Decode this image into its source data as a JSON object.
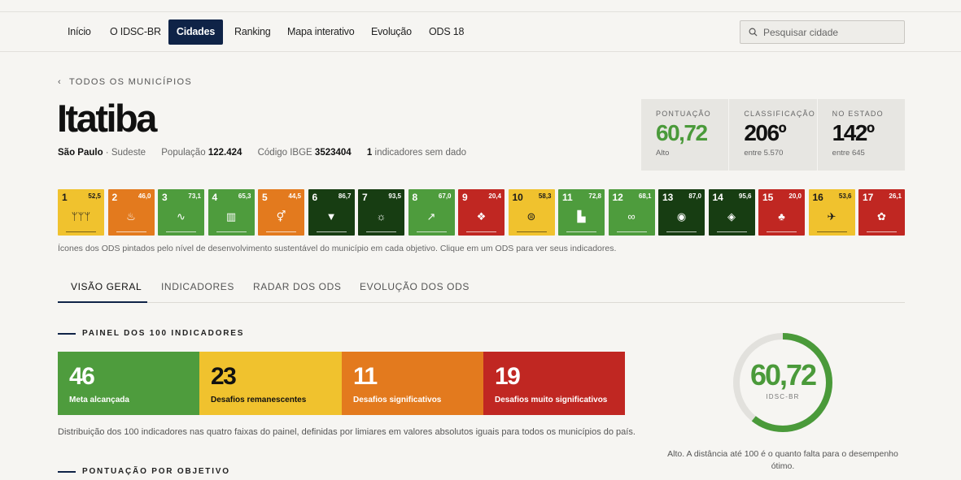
{
  "nav": {
    "items": [
      {
        "label": "Início"
      },
      {
        "label": "O IDSC-BR"
      },
      {
        "label": "Cidades"
      },
      {
        "label": "Ranking"
      },
      {
        "label": "Mapa interativo"
      },
      {
        "label": "Evolução"
      },
      {
        "label": "ODS 18"
      }
    ],
    "search_placeholder": "Pesquisar cidade"
  },
  "back_link": "TODOS OS MUNICÍPIOS",
  "city": {
    "name": "Itatiba",
    "state": "São Paulo",
    "region": "Sudeste",
    "population_label": "População",
    "population": "122.424",
    "ibge_label": "Código IBGE",
    "ibge": "3523404",
    "missing_count": "1",
    "missing_label": "indicadores sem dado"
  },
  "stats": [
    {
      "label": "PONTUAÇÃO",
      "value": "60,72",
      "sub": "Alto"
    },
    {
      "label": "CLASSIFICAÇÃO",
      "value": "206º",
      "sub": "entre 5.570"
    },
    {
      "label": "NO ESTADO",
      "value": "142º",
      "sub": "entre 645"
    }
  ],
  "ods": [
    {
      "num": "1",
      "score": "52,5",
      "color": "#f0c22e",
      "icon": "people-icon",
      "glyph": "ᛘᛘᛘ"
    },
    {
      "num": "2",
      "score": "46,0",
      "color": "#e37a1e",
      "icon": "bowl-icon",
      "glyph": "♨"
    },
    {
      "num": "3",
      "score": "73,1",
      "color": "#4e9c3d",
      "icon": "heartbeat-icon",
      "glyph": "∿"
    },
    {
      "num": "4",
      "score": "65,3",
      "color": "#4e9c3d",
      "icon": "book-icon",
      "glyph": "▥"
    },
    {
      "num": "5",
      "score": "44,5",
      "color": "#e37a1e",
      "icon": "gender-icon",
      "glyph": "⚥"
    },
    {
      "num": "6",
      "score": "86,7",
      "color": "#173d12",
      "icon": "water-icon",
      "glyph": "▼"
    },
    {
      "num": "7",
      "score": "93,5",
      "color": "#173d12",
      "icon": "sun-icon",
      "glyph": "☼"
    },
    {
      "num": "8",
      "score": "67,0",
      "color": "#4e9c3d",
      "icon": "growth-icon",
      "glyph": "↗"
    },
    {
      "num": "9",
      "score": "20,4",
      "color": "#c02722",
      "icon": "cubes-icon",
      "glyph": "❖"
    },
    {
      "num": "10",
      "score": "58,3",
      "color": "#f0c22e",
      "icon": "equality-icon",
      "glyph": "⊜"
    },
    {
      "num": "11",
      "score": "72,8",
      "color": "#4e9c3d",
      "icon": "city-icon",
      "glyph": "▙"
    },
    {
      "num": "12",
      "score": "68,1",
      "color": "#4e9c3d",
      "icon": "infinity-icon",
      "glyph": "∞"
    },
    {
      "num": "13",
      "score": "87,0",
      "color": "#173d12",
      "icon": "eye-icon",
      "glyph": "◉"
    },
    {
      "num": "14",
      "score": "95,6",
      "color": "#173d12",
      "icon": "fish-icon",
      "glyph": "◈"
    },
    {
      "num": "15",
      "score": "20,0",
      "color": "#c02722",
      "icon": "tree-icon",
      "glyph": "♣"
    },
    {
      "num": "16",
      "score": "53,6",
      "color": "#f0c22e",
      "icon": "dove-icon",
      "glyph": "✈"
    },
    {
      "num": "17",
      "score": "26,1",
      "color": "#c02722",
      "icon": "flower-icon",
      "glyph": "✿"
    }
  ],
  "ods_caption": "Ícones dos ODS pintados pelo nível de desenvolvimento sustentável do município em cada objetivo. Clique em um ODS para ver seus indicadores.",
  "tabs": [
    {
      "label": "VISÃO GERAL"
    },
    {
      "label": "INDICADORES"
    },
    {
      "label": "RADAR DOS ODS"
    },
    {
      "label": "EVOLUÇÃO DOS ODS"
    }
  ],
  "panel": {
    "title": "PAINEL DOS 100 INDICADORES",
    "cells": [
      {
        "value": "46",
        "label": "Meta alcançada",
        "color": "#4e9c3d"
      },
      {
        "value": "23",
        "label": "Desafios remanescentes",
        "color": "#f0c22e"
      },
      {
        "value": "11",
        "label": "Desafios significativos",
        "color": "#e37a1e"
      },
      {
        "value": "19",
        "label": "Desafios muito significativos",
        "color": "#c02722"
      }
    ],
    "caption": "Distribuição dos 100 indicadores nas quatro faixas do painel, definidas por limiares em valores absolutos iguais para todos os municípios do país."
  },
  "gauge": {
    "value": "60,72",
    "label": "IDSC-BR",
    "fraction": 0.6072,
    "color": "#4a9a3a",
    "caption": "Alto. A distância até 100 é o quanto falta para o desempenho ótimo."
  },
  "section2_title": "PONTUAÇÃO POR OBJETIVO"
}
